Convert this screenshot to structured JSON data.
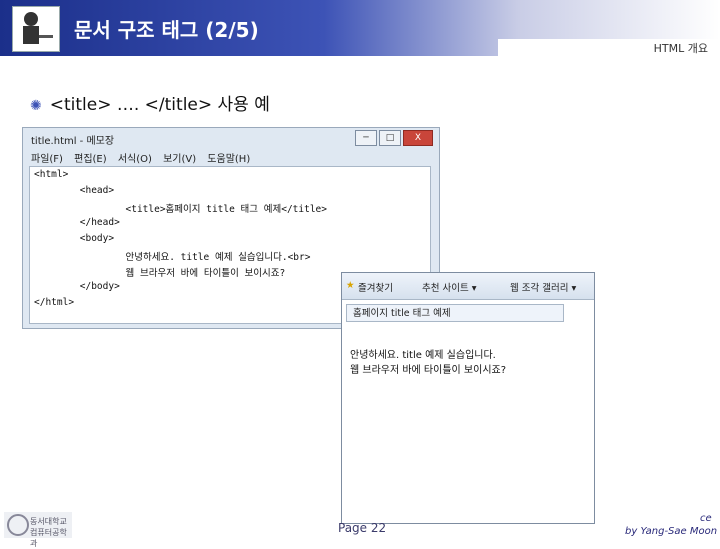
{
  "slide": {
    "title": "문서 구조 태그 (2/5)",
    "subtitle": "HTML 개요",
    "bullet": "<title> …. </title> 사용 예",
    "page": "Page 22",
    "credit_line1": "ce",
    "credit_line2": "by Yang-Sae Moon"
  },
  "notepad": {
    "title": "title.html - 메모장",
    "menu": "파일(F) 편집(E) 서식(O) 보기(V) 도움말(H)",
    "buttons": [
      "─",
      "□",
      "X"
    ],
    "code": [
      "<html>",
      "        <head>",
      "                <title>홈페이지 title 태그 예제</title>",
      "        </head>",
      "        <body>",
      "                안녕하세요. title 예제 실습입니다.<br>",
      "                웹 브라우저 바에 타이틀이 보이시죠?",
      "        </body>",
      "</html>"
    ]
  },
  "browser": {
    "favorites": "즐겨찾기",
    "suggested": "추천 사이트 ▾",
    "slices": "웹 조각 갤러리 ▾",
    "tab": "홈페이지 title 태그 예제",
    "body_lines": [
      "안녕하세요. title 예제 실습입니다.",
      "웹 브라우저 바에 타이틀이 보이시죠?"
    ]
  },
  "footer": {
    "logo_text": "동서대학교 컴퓨터공학과"
  }
}
